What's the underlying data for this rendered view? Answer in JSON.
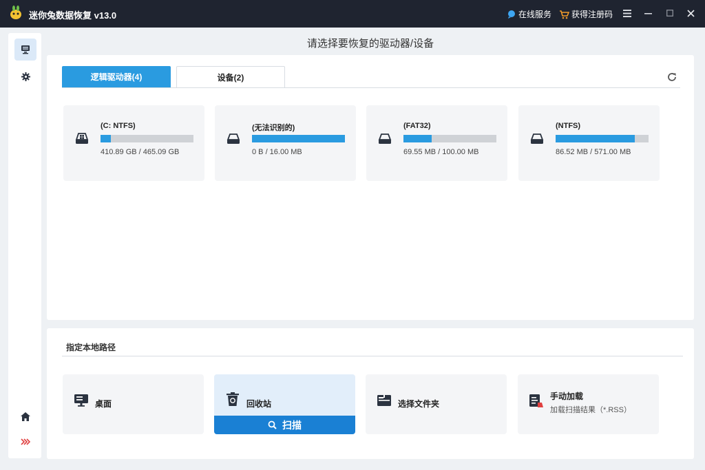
{
  "app": {
    "title": "迷你兔数据恢复 v13.0",
    "online_service": "在线服务",
    "get_code": "获得注册码"
  },
  "header": {
    "title": "请选择要恢复的驱动器/设备"
  },
  "tabs": [
    {
      "label": "逻辑驱动器(4)",
      "active": true
    },
    {
      "label": "设备(2)",
      "active": false
    }
  ],
  "drives": [
    {
      "label": "(C: NTFS)",
      "size": "410.89 GB / 465.09 GB",
      "used_fraction": 0.11,
      "icon": "windows-drive-icon"
    },
    {
      "label": "(无法识别的)",
      "size": "0 B / 16.00 MB",
      "used_fraction": 1.0,
      "icon": "drive-icon"
    },
    {
      "label": "(FAT32)",
      "size": "69.55 MB / 100.00 MB",
      "used_fraction": 0.3,
      "icon": "drive-icon"
    },
    {
      "label": "(NTFS)",
      "size": "86.52 MB / 571.00 MB",
      "used_fraction": 0.85,
      "icon": "drive-icon"
    }
  ],
  "local_path": {
    "title": "指定本地路径",
    "items": [
      {
        "label": "桌面",
        "icon": "desktop-icon"
      },
      {
        "label": "回收站",
        "icon": "recycle-bin-icon",
        "selected": true
      },
      {
        "label": "选择文件夹",
        "icon": "folder-icon"
      },
      {
        "label": "手动加载",
        "sublabel": "加载扫描结果（*.RSS）",
        "icon": "load-result-icon"
      }
    ],
    "scan_label": "扫描"
  },
  "colors": {
    "accent": "#2a9be0",
    "scan_button": "#1a80d4",
    "titlebar": "#1f2430"
  }
}
